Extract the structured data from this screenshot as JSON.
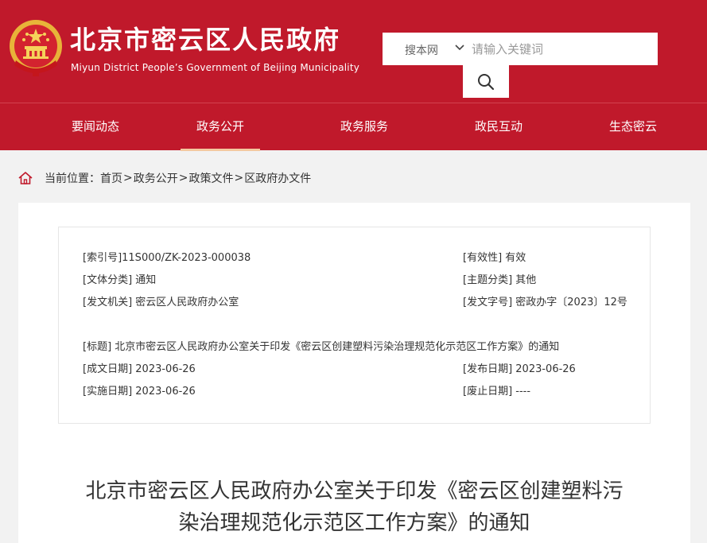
{
  "header": {
    "title": "北京市密云区人民政府",
    "subtitle": "Miyun District People’s Government of Beijing Municipality",
    "emblem_icon": "national-emblem-icon",
    "brand_color": "#c0192b"
  },
  "search": {
    "scope": "搜本网",
    "placeholder": "请输入关键词",
    "button_icon": "search-icon"
  },
  "nav": {
    "items": [
      {
        "label": "要闻动态"
      },
      {
        "label": "政务公开"
      },
      {
        "label": "政务服务"
      },
      {
        "label": "政民互动"
      },
      {
        "label": "生态密云"
      }
    ],
    "active": "政务公开"
  },
  "breadcrumb": {
    "prefix": "当前位置：",
    "items": [
      "首页",
      "政务公开",
      "政策文件",
      "区政府办文件"
    ],
    "separator": ">"
  },
  "meta": {
    "index_no": "[索引号]11S000/ZK-2023-000038",
    "validity": "[有效性] 有效",
    "doc_category": "[文体分类] 通知",
    "topic_category": "[主题分类] 其他",
    "issuer": "[发文机关] 密云区人民政府办公室",
    "doc_number": "[发文字号] 密政办字〔2023〕12号",
    "doc_title": "[标题] 北京市密云区人民政府办公室关于印发《密云区创建塑料污染治理规范化示范区工作方案》的通知",
    "created_date": "[成文日期] 2023-06-26",
    "published_date": "[发布日期] 2023-06-26",
    "effective_date": "[实施日期] 2023-06-26",
    "expiry_date": "[废止日期] ----"
  },
  "article": {
    "title_line1": "北京市密云区人民政府办公室关于印发《密云区创建塑料污",
    "title_line2": "染治理规范化示范区工作方案》的通知"
  }
}
